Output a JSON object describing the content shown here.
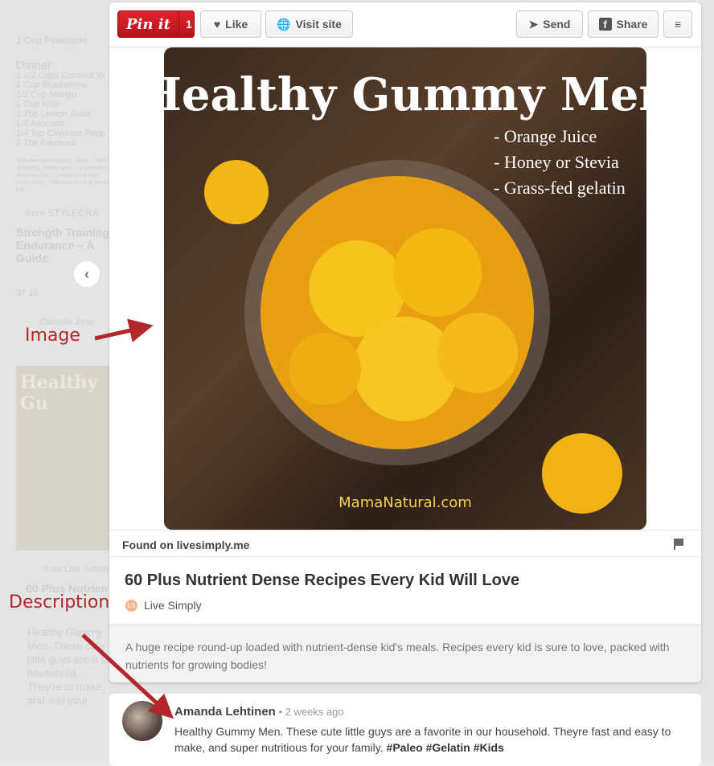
{
  "background": {
    "lines": [
      "1 Cup Pineapple"
    ],
    "dinner_heading": "Dinner:",
    "dinner_items": [
      "1 1/2 Cups Coconut W",
      "1 Cup Blueberries",
      "1/2 Cup Mango",
      "1 Cup Kale",
      "1 Tbs Lemon Juice",
      "1/4 Avocado",
      "1/4 Tsp Cayenne Pepp",
      "1 Tbs Flaxseed"
    ],
    "note": "Drink tea upon waking. Drink ... hour of waking. Follow with ... supplement. Have another ... supplement after lunch. Rep ... between lunch & dinner if h...",
    "pin_source": "from STYLECRA",
    "pin_title": "Strength Training Endurance – A Guide",
    "pin_stats": "37   10",
    "pin_user": "Danielle Jone",
    "card_title": "Healthy Gu",
    "card2_source": "from Live Simply",
    "card2_title": "60 Plus Nutrien",
    "card2_desc": "Healthy Gummy Men. These cute little guys are a fa household. They're to make, and sup your family. #Paleo #Gelatin #Kids"
  },
  "toolbar": {
    "pin_label": "Pin it",
    "pin_count": "1",
    "like_label": "Like",
    "visit_label": "Visit site",
    "send_label": "Send",
    "share_label": "Share"
  },
  "image": {
    "title": "Healthy Gummy Men",
    "bullets": [
      "- Orange Juice",
      "- Honey or Stevia",
      "- Grass-fed gelatin"
    ],
    "watermark": "MamaNatural.com"
  },
  "found_on": "Found on livesimply.me",
  "pin": {
    "title": "60 Plus Nutrient Dense Recipes Every Kid Will Love",
    "source": "Live Simply",
    "source_icon_text": "LS",
    "description": "A huge recipe round-up loaded with nutrient-dense kid's meals. Recipes every kid is sure to love, packed with nutrients for growing bodies!"
  },
  "comment": {
    "author": "Amanda Lehtinen",
    "time": " • 2 weeks ago",
    "text": "Healthy Gummy Men. These cute little guys are a favorite in our household. Theyre fast and easy to make, and super nutritious for your family. ",
    "tags": [
      "#Paleo",
      "#Gelatin",
      "#Kids"
    ]
  },
  "annotations": {
    "image": "Image",
    "description": "Description"
  },
  "colors": {
    "pin_red": "#cb2027",
    "annotation_red": "#b3262a"
  }
}
